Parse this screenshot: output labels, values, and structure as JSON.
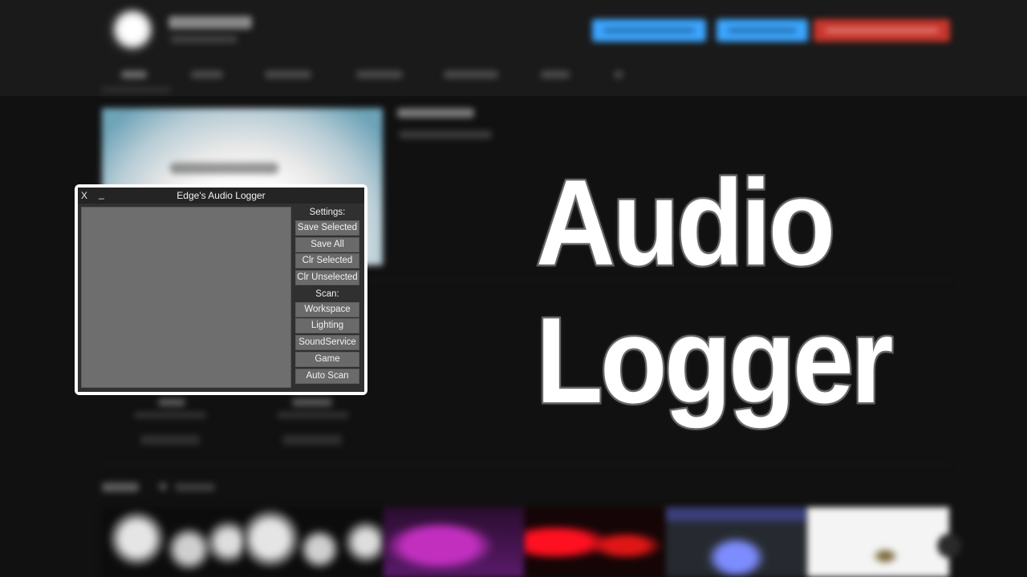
{
  "logger": {
    "title": "Edge's Audio Logger",
    "close_label": "X",
    "minimize_label": "_",
    "settings_label": "Settings:",
    "settings_buttons": [
      "Save Selected",
      "Save All",
      "Clr Selected",
      "Clr Unselected"
    ],
    "scan_label": "Scan:",
    "scan_buttons": [
      "Workspace",
      "Lighting",
      "SoundService",
      "Game",
      "Auto Scan"
    ],
    "audio_list_items": []
  },
  "overlay_title": {
    "line1": "Audio",
    "line2": "Logger"
  },
  "colors": {
    "page_background": "#111111",
    "window_frame": "#ffffff",
    "window_body": "#303030",
    "titlebar": "#242424",
    "list_background": "#6e6e6e",
    "button_background": "#6a6a6a",
    "subscribe_blue": "#3ba6ff",
    "subscribe_red": "#c9362c"
  }
}
